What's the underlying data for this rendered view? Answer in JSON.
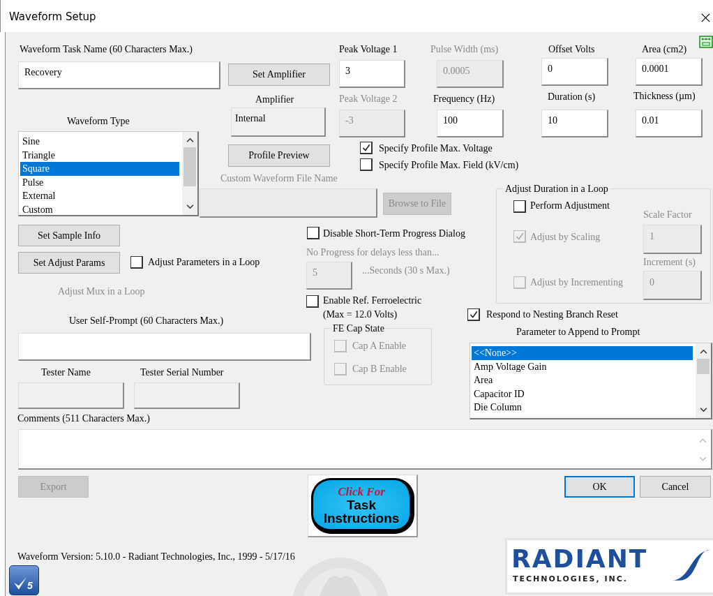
{
  "window": {
    "title": "Waveform Setup"
  },
  "task_name": {
    "label": "Waveform Task Name  (60 Characters Max.)",
    "value": "Recovery"
  },
  "set_amplifier_button": "Set Amplifier",
  "amplifier": {
    "label": "Amplifier",
    "value": "Internal"
  },
  "profile_preview_button": "Profile Preview",
  "waveform_type": {
    "label": "Waveform Type",
    "items": [
      {
        "label": "Sine",
        "selected": false
      },
      {
        "label": "Triangle",
        "selected": false
      },
      {
        "label": "Square",
        "selected": true
      },
      {
        "label": "Pulse",
        "selected": false
      },
      {
        "label": "External",
        "selected": false
      },
      {
        "label": "Custom",
        "selected": false
      }
    ]
  },
  "fields": [
    {
      "label": "Peak Voltage 1",
      "value": "3",
      "disabled": false
    },
    {
      "label": "Pulse Width (ms)",
      "value": "0.0005",
      "disabled": true
    },
    {
      "label": "Offset Volts",
      "value": "0",
      "disabled": false
    },
    {
      "label": "Area (cm2)",
      "value": "0.0001",
      "disabled": false
    },
    {
      "label": "Peak Voltage 2",
      "value": "-3",
      "disabled": true
    },
    {
      "label": "Frequency (Hz)",
      "value": "100",
      "disabled": false
    },
    {
      "label": "Duration (s)",
      "value": "10",
      "disabled": false
    },
    {
      "label": "Thickness (µm)",
      "value": "0.01",
      "disabled": false
    }
  ],
  "profile_checks": [
    {
      "label": "Specify Profile Max. Voltage",
      "checked": true
    },
    {
      "label": "Specify Profile Max. Field (kV/cm)",
      "checked": false
    }
  ],
  "custom_file": {
    "label": "Custom Waveform File Name",
    "disabled": true
  },
  "browse_button": {
    "label": "Browse to File",
    "disabled": true
  },
  "set_sample_info_button": "Set Sample Info",
  "set_adjust_params_button": "Set Adjust Params",
  "adjust_params_loop": {
    "label": "Adjust Parameters in a Loop",
    "checked": false
  },
  "adjust_mux": {
    "label": "Adjust Mux in a Loop",
    "disabled": true
  },
  "progress": {
    "label": "Disable Short-Term Progress Dialog",
    "checked": false,
    "hint": "No Progress for delays less than...",
    "value": "5",
    "unit": "...Seconds (30 s Max.)",
    "disabled": true
  },
  "ref_fe": {
    "label": "Enable Ref. Ferroelectric",
    "note": "(Max = 12.0 Volts)",
    "checked": false,
    "group_title": "FE Cap State",
    "caps": [
      {
        "label": "Cap A Enable",
        "checked": false
      },
      {
        "label": "Cap B Enable",
        "checked": false
      }
    ],
    "disabled": true
  },
  "duration_loop": {
    "title": "Adjust Duration in a Loop",
    "disabled": true,
    "perform": {
      "label": "Perform Adjustment",
      "checked": false
    },
    "scaling": {
      "label": "Adjust by Scaling",
      "checked": true
    },
    "scale_factor": {
      "label": "Scale Factor",
      "value": "1"
    },
    "incrementing": {
      "label": "Adjust by Incrementing",
      "checked": false
    },
    "increment": {
      "label": "Increment (s)",
      "value": "0"
    }
  },
  "nesting_reset": {
    "label": "Respond to Nesting Branch Reset",
    "checked": true
  },
  "append_param": {
    "label": "Parameter to Append to Prompt",
    "items": [
      {
        "label": "<<None>>",
        "selected": true
      },
      {
        "label": "Amp Voltage Gain",
        "selected": false
      },
      {
        "label": "Area",
        "selected": false
      },
      {
        "label": "Capacitor ID",
        "selected": false
      },
      {
        "label": "Die Column",
        "selected": false
      }
    ]
  },
  "self_prompt": {
    "label": "User Self-Prompt (60 Characters Max.)"
  },
  "tester_name": {
    "label": "Tester Name"
  },
  "tester_serial": {
    "label": "Tester Serial Number"
  },
  "comments": {
    "label": "Comments (511 Characters Max.)"
  },
  "export_button": {
    "label": "Export",
    "disabled": true
  },
  "instructions_button": {
    "line1": "Click For",
    "line2": "Task",
    "line3": "Instructions"
  },
  "ok_button": "OK",
  "cancel_button": "Cancel",
  "version": "Waveform Version: 5.10.0 - Radiant Technologies, Inc., 1999 - 5/17/16",
  "version_badge": "5",
  "logo": {
    "name": "RADIANT",
    "subtitle": "TECHNOLOGIES, INC."
  }
}
